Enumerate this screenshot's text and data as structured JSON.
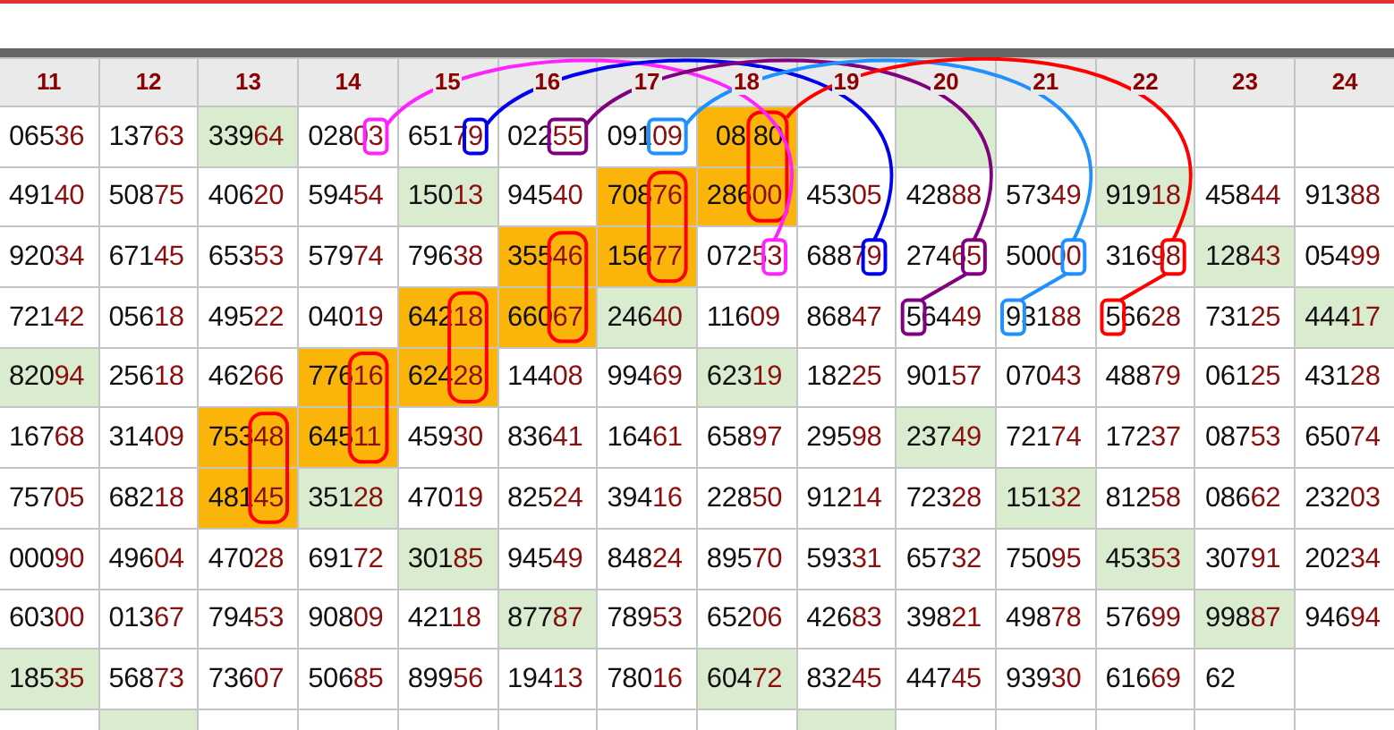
{
  "columns": [
    "11",
    "12",
    "13",
    "14",
    "15",
    "16",
    "17",
    "18",
    "19",
    "20",
    "21",
    "22",
    "23",
    "24"
  ],
  "rows": [
    [
      {
        "value": "06536"
      },
      {
        "value": "13763"
      },
      {
        "value": "33964",
        "color": "#d9ecd0"
      },
      {
        "value": "02803",
        "box": {
          "kind": "last1",
          "color": "#ff22ff"
        }
      },
      {
        "value": "65179",
        "box": {
          "kind": "last1",
          "color": "#0000ee"
        }
      },
      {
        "value": "02255",
        "box": {
          "kind": "last2",
          "color": "#800080"
        }
      },
      {
        "value": "09109",
        "box": {
          "kind": "last2",
          "color": "#1e90ff"
        }
      },
      {
        "value": "08 80",
        "color": "#fbb40a",
        "kind": "result",
        "oval": true,
        "box": {
          "kind": "last2",
          "color": "#ff0000"
        }
      },
      {},
      {
        "color": "#d9ecd0"
      },
      {},
      {},
      {},
      {}
    ],
    [
      {
        "value": "49140"
      },
      {
        "value": "50875"
      },
      {
        "value": "40620"
      },
      {
        "value": "59454"
      },
      {
        "value": "15013",
        "color": "#d9ecd0"
      },
      {
        "value": "94540"
      },
      {
        "value": "70876",
        "color": "#fbb40a",
        "oval": true
      },
      {
        "value": "28600",
        "color": "#fbb40a"
      },
      {
        "value": "45305"
      },
      {
        "value": "42888"
      },
      {
        "value": "57349"
      },
      {
        "value": "91918",
        "color": "#d9ecd0"
      },
      {
        "value": "45844"
      },
      {
        "value": "91388"
      }
    ],
    [
      {
        "value": "92034"
      },
      {
        "value": "67145"
      },
      {
        "value": "65353"
      },
      {
        "value": "57974"
      },
      {
        "value": "79638"
      },
      {
        "value": "35546",
        "color": "#fbb40a",
        "oval": true
      },
      {
        "value": "15677",
        "color": "#fbb40a"
      },
      {
        "value": "07253",
        "box": {
          "kind": "last1",
          "color": "#ff22ff"
        }
      },
      {
        "value": "68879",
        "box": {
          "kind": "last1",
          "color": "#0000ee"
        }
      },
      {
        "value": "27465",
        "box": {
          "kind": "last1",
          "color": "#800080"
        }
      },
      {
        "value": "50000",
        "box": {
          "kind": "last1",
          "color": "#1e90ff"
        }
      },
      {
        "value": "31698",
        "box": {
          "kind": "last1",
          "color": "#ff0000"
        }
      },
      {
        "value": "12843",
        "color": "#d9ecd0"
      },
      {
        "value": "05499"
      }
    ],
    [
      {
        "value": "72142"
      },
      {
        "value": "05618"
      },
      {
        "value": "49522"
      },
      {
        "value": "04019"
      },
      {
        "value": "64218",
        "color": "#fbb40a",
        "oval": true
      },
      {
        "value": "66067",
        "color": "#fbb40a"
      },
      {
        "value": "24640",
        "color": "#d9ecd0"
      },
      {
        "value": "11609"
      },
      {
        "value": "86847"
      },
      {
        "value": "56449",
        "box": {
          "kind": "first1",
          "color": "#800080"
        }
      },
      {
        "value": "93188",
        "box": {
          "kind": "first1",
          "color": "#1e90ff"
        }
      },
      {
        "value": "56628",
        "box": {
          "kind": "first1",
          "color": "#ff0000"
        }
      },
      {
        "value": "73125"
      },
      {
        "value": "44417",
        "color": "#d9ecd0"
      }
    ],
    [
      {
        "value": "82094",
        "color": "#d9ecd0"
      },
      {
        "value": "25618"
      },
      {
        "value": "46266"
      },
      {
        "value": "77616",
        "color": "#fbb40a",
        "oval": true
      },
      {
        "value": "62428",
        "color": "#fbb40a"
      },
      {
        "value": "14408"
      },
      {
        "value": "99469"
      },
      {
        "value": "62319",
        "color": "#d9ecd0"
      },
      {
        "value": "18225"
      },
      {
        "value": "90157"
      },
      {
        "value": "07043"
      },
      {
        "value": "48879"
      },
      {
        "value": "06125"
      },
      {
        "value": "43128"
      }
    ],
    [
      {
        "value": "16768"
      },
      {
        "value": "31409"
      },
      {
        "value": "75348",
        "color": "#fbb40a",
        "oval": true
      },
      {
        "value": "64511",
        "color": "#fbb40a"
      },
      {
        "value": "45930"
      },
      {
        "value": "83641"
      },
      {
        "value": "16461"
      },
      {
        "value": "65897"
      },
      {
        "value": "29598"
      },
      {
        "value": "23749",
        "color": "#d9ecd0"
      },
      {
        "value": "72174"
      },
      {
        "value": "17237"
      },
      {
        "value": "08753"
      },
      {
        "value": "65074"
      }
    ],
    [
      {
        "value": "75705"
      },
      {
        "value": "68218"
      },
      {
        "value": "48145",
        "color": "#fbb40a"
      },
      {
        "value": "35128",
        "color": "#d9ecd0"
      },
      {
        "value": "47019"
      },
      {
        "value": "82524"
      },
      {
        "value": "39416"
      },
      {
        "value": "22850"
      },
      {
        "value": "91214"
      },
      {
        "value": "72328"
      },
      {
        "value": "15132",
        "color": "#d9ecd0"
      },
      {
        "value": "81258"
      },
      {
        "value": "08662"
      },
      {
        "value": "23203"
      }
    ],
    [
      {
        "value": "00090"
      },
      {
        "value": "49604"
      },
      {
        "value": "47028"
      },
      {
        "value": "69172"
      },
      {
        "value": "30185",
        "color": "#d9ecd0"
      },
      {
        "value": "94549"
      },
      {
        "value": "84824"
      },
      {
        "value": "89570"
      },
      {
        "value": "59331"
      },
      {
        "value": "65732"
      },
      {
        "value": "75095"
      },
      {
        "value": "45353",
        "color": "#d9ecd0"
      },
      {
        "value": "30791"
      },
      {
        "value": "20234"
      }
    ],
    [
      {
        "value": "60300"
      },
      {
        "value": "01367"
      },
      {
        "value": "79453"
      },
      {
        "value": "90809"
      },
      {
        "value": "42118"
      },
      {
        "value": "87787",
        "color": "#d9ecd0"
      },
      {
        "value": "78953"
      },
      {
        "value": "65206"
      },
      {
        "value": "42683"
      },
      {
        "value": "39821"
      },
      {
        "value": "49878"
      },
      {
        "value": "57699"
      },
      {
        "value": "99887",
        "color": "#d9ecd0"
      },
      {
        "value": "94694"
      }
    ],
    [
      {
        "value": "18535",
        "color": "#d9ecd0"
      },
      {
        "value": "56873"
      },
      {
        "value": "73607"
      },
      {
        "value": "50685"
      },
      {
        "value": "89956"
      },
      {
        "value": "19413"
      },
      {
        "value": "78016"
      },
      {
        "value": "60472",
        "color": "#d9ecd0"
      },
      {
        "value": "83245"
      },
      {
        "value": "44745"
      },
      {
        "value": "93930"
      },
      {
        "value": "61669"
      },
      {
        "value": "62"
      },
      {}
    ],
    [
      {},
      {
        "color": "#d9ecd0"
      },
      {},
      {},
      {},
      {},
      {},
      {},
      {
        "color": "#d9ecd0"
      },
      {},
      {},
      {},
      {},
      {}
    ]
  ]
}
